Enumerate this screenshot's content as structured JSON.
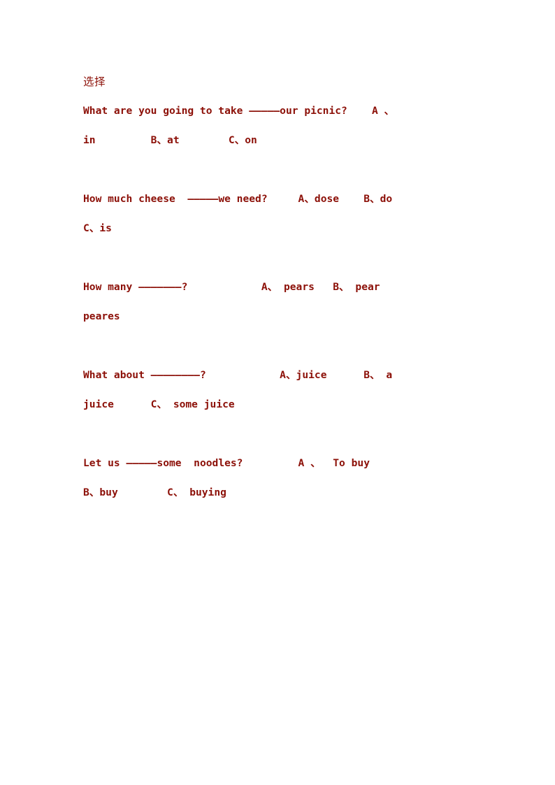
{
  "document": {
    "heading": "选择",
    "text_color": "#8C1008",
    "background_color": "#FFFFFF",
    "questions": [
      {
        "id": "q1",
        "line1": "What are you going to take ",
        "blank": "—————",
        "line1_after": "our picnic?    A 、",
        "line2": "in         B、at        C、on"
      },
      {
        "id": "q2",
        "line1": "How much cheese  ",
        "blank": "—————",
        "line1_after": "we need?     A、dose    B、do",
        "line2": "C、is"
      },
      {
        "id": "q3",
        "line1": "How many ",
        "blank": "———————",
        "line1_after": "?            A、 pears   B、 pear",
        "line2": "peares"
      },
      {
        "id": "q4",
        "line1": "What about ",
        "blank": "————————",
        "line1_after": "?            A、juice      B、 a",
        "line2": "juice      C、 some juice"
      },
      {
        "id": "q5",
        "line1": "Let us ",
        "blank": "—————",
        "line1_after": "some  noodles?         A 、  To buy",
        "line2": "B、buy        C、 buying"
      }
    ]
  }
}
